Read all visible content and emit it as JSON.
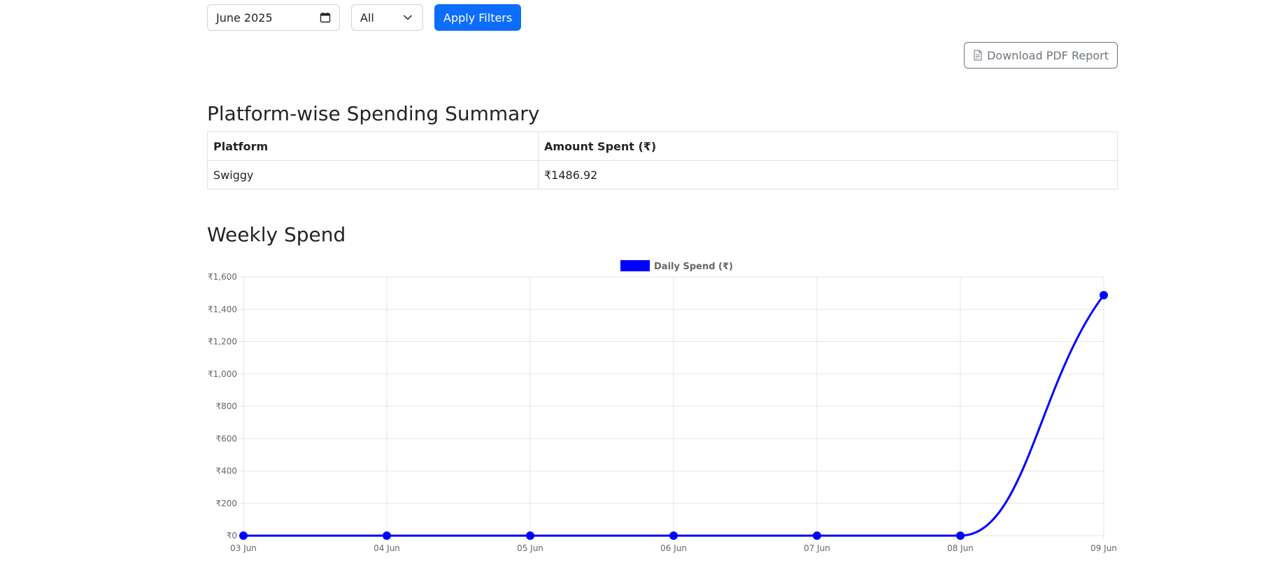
{
  "filters": {
    "month_value": "June 2025",
    "platform_value": "All",
    "apply_label": "Apply Filters"
  },
  "download": {
    "label": "Download PDF Report"
  },
  "summary": {
    "title": "Platform-wise Spending Summary",
    "columns": [
      "Platform",
      "Amount Spent (₹)"
    ],
    "rows": [
      [
        "Swiggy",
        "₹1486.92"
      ]
    ]
  },
  "weekly": {
    "title": "Weekly Spend"
  },
  "colors": {
    "primary": "#0d6efd",
    "series": "#0000ff",
    "secondary": "#6c757d"
  },
  "chart_data": {
    "type": "line",
    "categories": [
      "03 Jun",
      "04 Jun",
      "05 Jun",
      "06 Jun",
      "07 Jun",
      "08 Jun",
      "09 Jun"
    ],
    "series": [
      {
        "name": "Daily Spend (₹)",
        "values": [
          0,
          0,
          0,
          0,
          0,
          0,
          1486.92
        ]
      }
    ],
    "ylim": [
      0,
      1600
    ],
    "yticks": [
      0,
      200,
      400,
      600,
      800,
      1000,
      1200,
      1400,
      1600
    ],
    "ytick_labels": [
      "₹0",
      "₹200",
      "₹400",
      "₹600",
      "₹800",
      "₹1,000",
      "₹1,200",
      "₹1,400",
      "₹1,600"
    ],
    "grid": true,
    "legend": "top-center",
    "title": "",
    "xlabel": "",
    "ylabel": ""
  }
}
